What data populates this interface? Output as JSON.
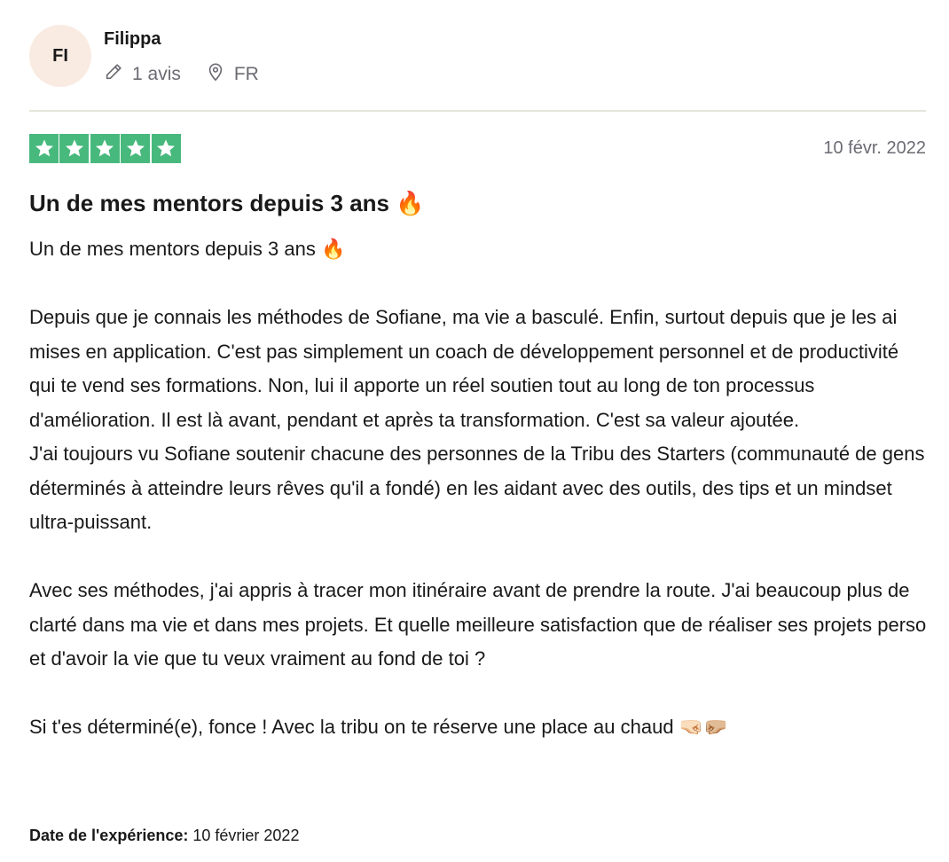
{
  "consumer": {
    "initials": "FI",
    "name": "Filippa",
    "reviews_count": "1 avis",
    "country": "FR"
  },
  "review": {
    "rating": 5,
    "rating_max": 5,
    "date": "10 févr. 2022",
    "title": "Un de mes mentors depuis 3 ans 🔥",
    "body": "Un de mes mentors depuis 3 ans 🔥\n\nDepuis que je connais les méthodes de Sofiane, ma vie a basculé. Enfin, surtout depuis que je les ai mises en application. C'est pas simplement un coach de développement personnel et de productivité qui te vend ses formations. Non, lui il apporte un réel soutien tout au long de ton processus d'amélioration. Il est là avant, pendant et après ta transformation. C'est sa valeur ajoutée.\nJ'ai toujours vu Sofiane soutenir chacune des personnes de la Tribu des Starters (communauté de gens déterminés à atteindre leurs rêves qu'il a fondé) en les aidant avec des outils, des tips et un mindset ultra-puissant.\n\nAvec ses méthodes, j'ai appris à tracer mon itinéraire avant de prendre la route. J'ai beaucoup plus de clarté dans ma vie et dans mes projets. Et quelle meilleure satisfaction que de réaliser ses projets perso et d'avoir la vie que tu veux vraiment au fond de toi ?\n\nSi t'es déterminé(e), fonce ! Avec la tribu on te réserve une place au chaud 🤜🏻🤛🏼",
    "experience_label": "Date de l'expérience:",
    "experience_date": "10 février 2022"
  },
  "colors": {
    "star_green": "#48b97d",
    "avatar_bg": "#f9ebe2",
    "muted_text": "#6b6b73",
    "divider": "#e5e5dd"
  },
  "icons": {
    "reviews": "pencil-icon",
    "country": "location-pin-icon",
    "star": "star-icon"
  }
}
